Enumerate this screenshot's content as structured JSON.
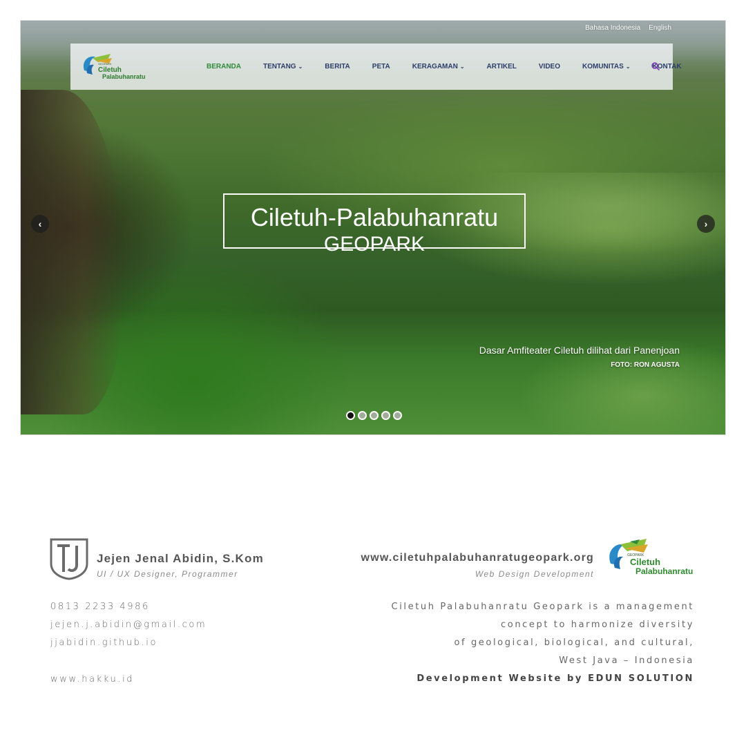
{
  "hero": {
    "language_options": [
      "Bahasa Indonesia",
      "English"
    ],
    "nav": {
      "logo": {
        "small": "GEOPARK",
        "line1": "Ciletuh",
        "line2": "Palabuhanratu"
      },
      "items": [
        {
          "label": "BERANDA",
          "active": true,
          "has_dropdown": false
        },
        {
          "label": "TENTANG",
          "active": false,
          "has_dropdown": true
        },
        {
          "label": "BERITA",
          "active": false,
          "has_dropdown": false
        },
        {
          "label": "PETA",
          "active": false,
          "has_dropdown": false
        },
        {
          "label": "KERAGAMAN",
          "active": false,
          "has_dropdown": true
        },
        {
          "label": "ARTIKEL",
          "active": false,
          "has_dropdown": false
        },
        {
          "label": "VIDEO",
          "active": false,
          "has_dropdown": false
        },
        {
          "label": "KOMUNITAS",
          "active": false,
          "has_dropdown": true
        },
        {
          "label": "KONTAK",
          "active": false,
          "has_dropdown": false
        }
      ],
      "search_icon": "search-icon",
      "active_color": "#2f8a3a",
      "item_color": "#2d3d6b"
    },
    "title": "Ciletuh-Palabuhanratu",
    "subtitle": "GEOPARK",
    "caption": "Dasar Amfiteater Ciletuh dilihat dari Panenjoan",
    "credit": "FOTO: RON AGUSTA",
    "prev_icon": "chevron-left-icon",
    "next_icon": "chevron-right-icon",
    "slides_total": 5,
    "active_slide": 1
  },
  "author": {
    "name": "Jejen Jenal Abidin, S.Kom",
    "role": "UI / UX Designer, Programmer",
    "phone": "0813 2233 4986",
    "email": "jejen.j.abidin@gmail.com",
    "github": "jjabidin.github.io",
    "site": "www.hakku.id"
  },
  "project": {
    "url": "www.ciletuhpalabuhanratugeopark.org",
    "subtitle": "Web Design Development",
    "logo": {
      "small": "GEOPARK",
      "line1": "Ciletuh",
      "line2": "Palabuhanratu"
    },
    "description": [
      "Ciletuh Palabuhanratu Geopark is a management",
      "concept to harmonize diversity",
      "of geological, biological, and cultural,",
      "West Java – Indonesia"
    ],
    "credit": "Development Website by EDUN SOLUTION"
  }
}
